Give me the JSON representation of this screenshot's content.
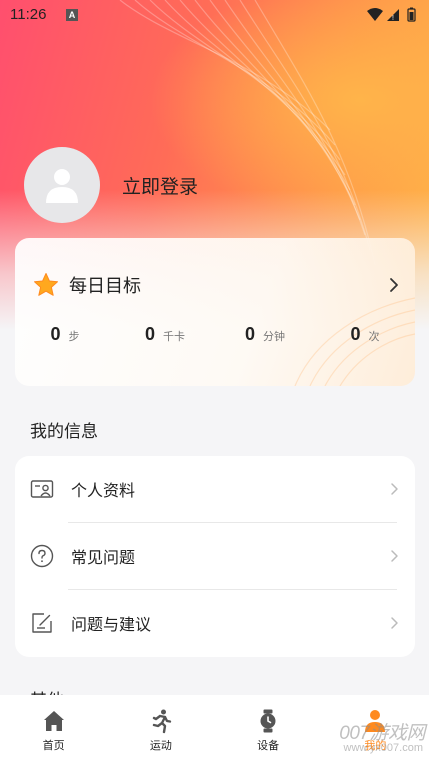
{
  "status_bar": {
    "time": "11:26",
    "notification_badge": "A"
  },
  "profile": {
    "login_label": "立即登录"
  },
  "daily_goal": {
    "title": "每日目标",
    "stats": [
      {
        "value": "0",
        "unit": "步"
      },
      {
        "value": "0",
        "unit": "千卡"
      },
      {
        "value": "0",
        "unit": "分钟"
      },
      {
        "value": "0",
        "unit": "次"
      }
    ]
  },
  "my_info": {
    "section_title": "我的信息",
    "items": [
      {
        "label": "个人资料",
        "icon": "id-card-icon"
      },
      {
        "label": "常见问题",
        "icon": "question-circle-icon"
      },
      {
        "label": "问题与建议",
        "icon": "edit-note-icon"
      }
    ]
  },
  "other_section": {
    "title": "其他"
  },
  "tab_bar": {
    "tabs": [
      {
        "label": "首页",
        "icon": "home-icon",
        "active": false
      },
      {
        "label": "运动",
        "icon": "running-icon",
        "active": false
      },
      {
        "label": "设备",
        "icon": "watch-icon",
        "active": false
      },
      {
        "label": "我的",
        "icon": "profile-icon",
        "active": true
      }
    ]
  },
  "watermark": {
    "main": "007游戏网",
    "url": "www.yx007.com"
  },
  "colors": {
    "accent": "#ff8a1f",
    "hero_pink": "#ff4f6e",
    "hero_orange": "#ffb547",
    "star": "#ffa81e"
  }
}
